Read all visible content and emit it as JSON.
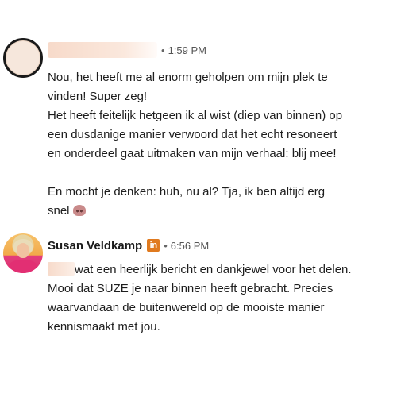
{
  "messages": [
    {
      "sender": "",
      "timestamp": "1:59 PM",
      "separator": "•",
      "lines": [
        "Nou, het heeft me al enorm geholpen om mijn plek te",
        "vinden! Super zeg!",
        "Het heeft feitelijk hetgeen ik al wist (diep van binnen) op",
        "een dusdanige manier verwoord dat het echt resoneert",
        "en onderdeel gaat uitmaken van mijn verhaal: blij mee!",
        "",
        "En mocht je denken: huh, nu al? Tja, ik ben altijd erg",
        "snel"
      ],
      "emoji_icon": "see-no-evil-monkey-icon"
    },
    {
      "sender": "Susan Veldkamp",
      "badge": "in",
      "badge_color": "#e07a1f",
      "timestamp": "6:56 PM",
      "separator": "•",
      "lines": [
        "wat een heerlijk bericht en dankjewel voor het delen.",
        "Mooi dat SUZE je naar binnen heeft gebracht. Precies",
        "waarvandaan de buitenwereld op de mooiste manier",
        "kennismaakt met jou."
      ]
    }
  ]
}
